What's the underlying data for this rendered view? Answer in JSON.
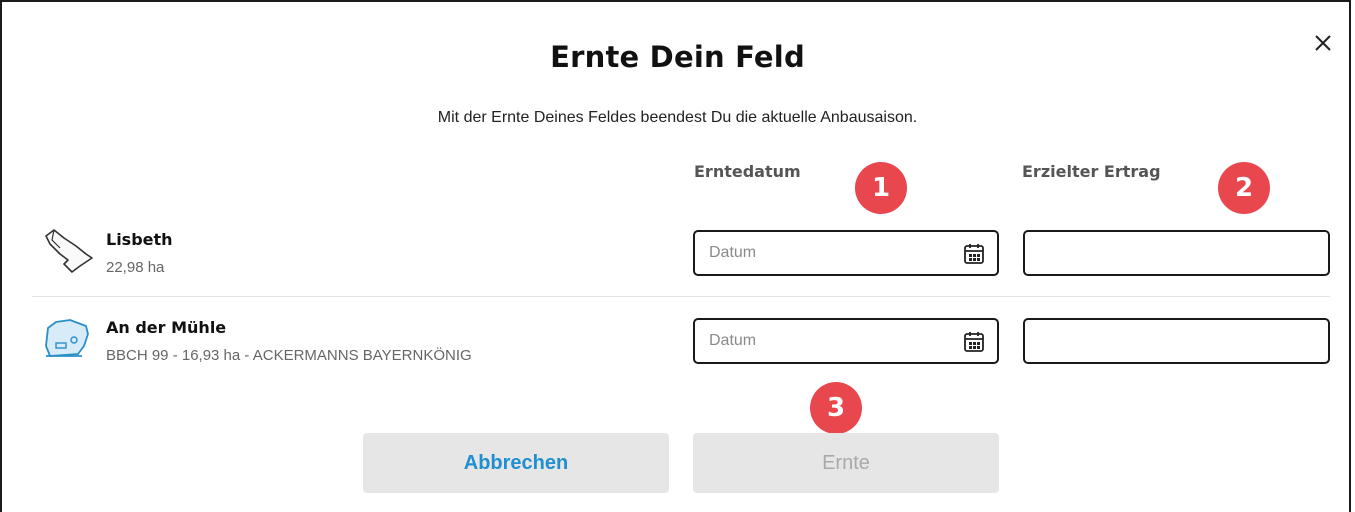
{
  "dialog": {
    "title": "Ernte Dein Feld",
    "subtitle": "Mit der Ernte Deines Feldes beendest Du die aktuelle Anbausaison.",
    "close_icon": "close-icon"
  },
  "columns": {
    "date": "Erntedatum",
    "yield": "Erzielter Ertrag"
  },
  "markers": [
    "1",
    "2",
    "3"
  ],
  "fields": [
    {
      "name": "Lisbeth",
      "meta": "22,98 ha",
      "icon": "field-outline-icon",
      "date_placeholder": "Datum",
      "yield_value": ""
    },
    {
      "name": "An der Mühle",
      "meta": "BBCH 99 - 16,93 ha - ACKERMANNS BAYERNKÖNIG",
      "icon": "field-crop-icon",
      "date_placeholder": "Datum",
      "yield_value": ""
    }
  ],
  "buttons": {
    "cancel": "Abbrechen",
    "harvest": "Ernte"
  },
  "colors": {
    "marker": "#e8474d",
    "link_blue": "#1f8fd0",
    "field_icon_blue": "#2a8fc9",
    "button_bg": "#e6e6e6"
  }
}
